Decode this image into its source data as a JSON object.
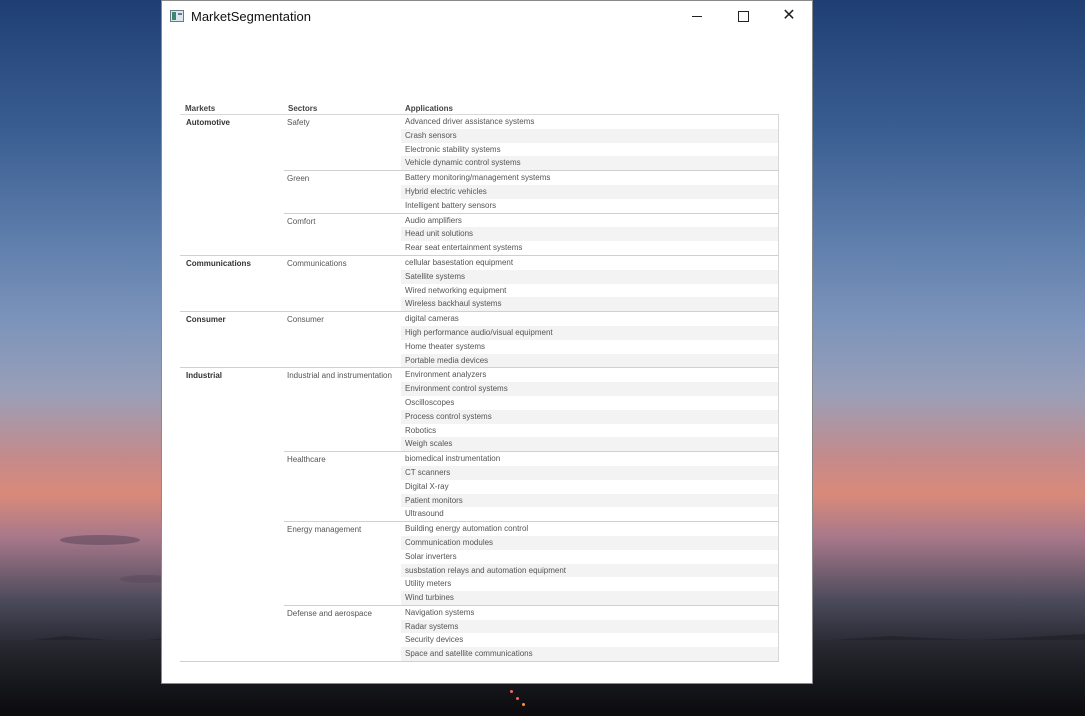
{
  "window": {
    "title": "MarketSegmentation"
  },
  "table": {
    "headers": {
      "markets": "Markets",
      "sectors": "Sectors",
      "applications": "Applications"
    },
    "markets": [
      {
        "name": "Automotive",
        "sectors": [
          {
            "name": "Safety",
            "apps": [
              "Advanced driver assistance systems",
              "Crash sensors",
              "Electronic stability systems",
              "Vehicle dynamic control systems"
            ]
          },
          {
            "name": "Green",
            "apps": [
              "Battery monitoring/management systems",
              "Hybrid electric vehicles",
              "Intelligent battery sensors"
            ]
          },
          {
            "name": "Comfort",
            "apps": [
              "Audio amplifiers",
              "Head unit solutions",
              "Rear seat entertainment systems"
            ]
          }
        ]
      },
      {
        "name": "Communications",
        "sectors": [
          {
            "name": "Communications",
            "apps": [
              "cellular basestation equipment",
              "Satellite systems",
              "Wired networking equipment",
              "Wireless backhaul systems"
            ]
          }
        ]
      },
      {
        "name": "Consumer",
        "sectors": [
          {
            "name": "Consumer",
            "apps": [
              "digital cameras",
              "High performance audio/visual equipment",
              "Home theater systems",
              "Portable media devices"
            ]
          }
        ]
      },
      {
        "name": "Industrial",
        "sectors": [
          {
            "name": "Industrial and instrumentation",
            "apps": [
              "Environment analyzers",
              "Environment control systems",
              "Oscilloscopes",
              "Process control systems",
              "Robotics",
              "Weigh scales"
            ]
          },
          {
            "name": "Healthcare",
            "apps": [
              "biomedical instrumentation",
              "CT scanners",
              "Digital X-ray",
              "Patient monitors",
              "Ultrasound"
            ]
          },
          {
            "name": "Energy management",
            "apps": [
              "Building energy automation control",
              "Communication modules",
              "Solar inverters",
              "susbstation relays and automation equipment",
              "Utility meters",
              "Wind turbines"
            ]
          },
          {
            "name": "Defense and aerospace",
            "apps": [
              "Navigation systems",
              "Radar systems",
              "Security devices",
              "Space and satellite communications"
            ]
          }
        ]
      }
    ]
  }
}
